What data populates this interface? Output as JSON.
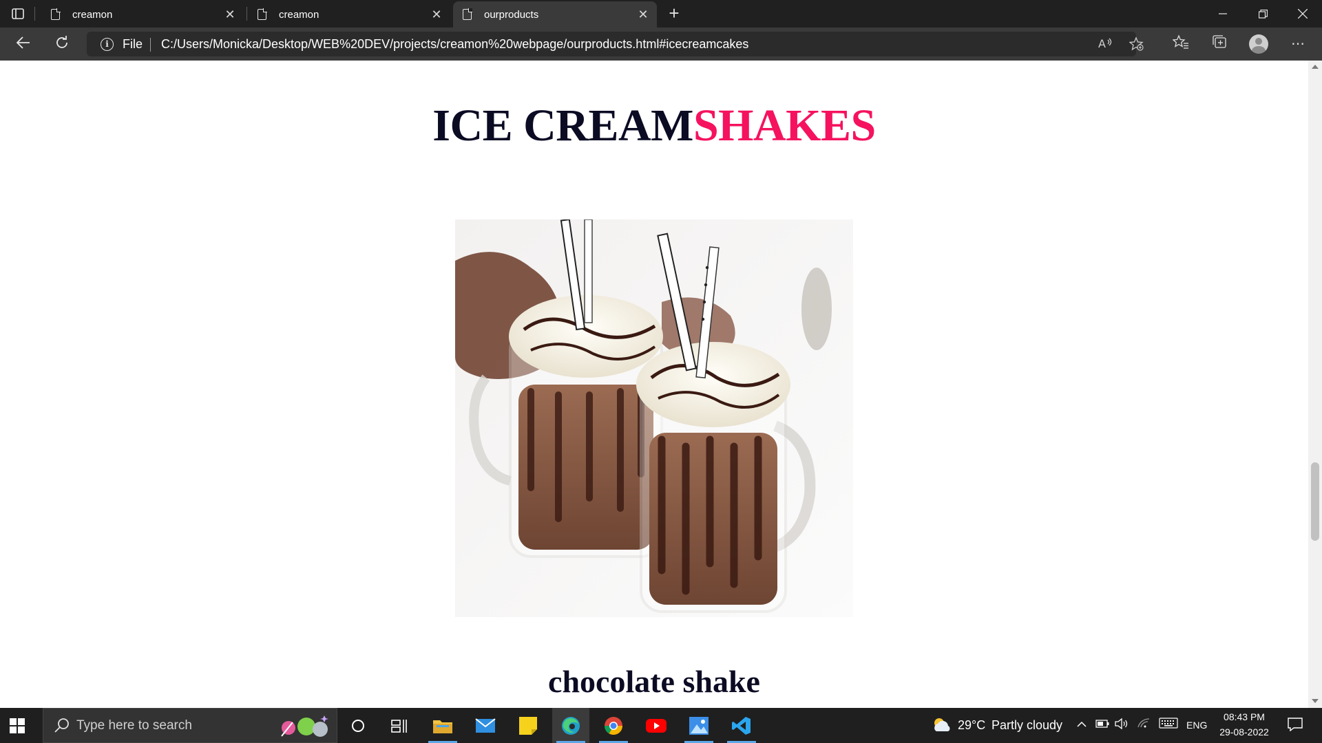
{
  "browser": {
    "tabs": [
      {
        "label": "creamon",
        "active": false
      },
      {
        "label": "creamon",
        "active": false
      },
      {
        "label": "ourproducts",
        "active": true
      }
    ],
    "address": {
      "scheme_label": "File",
      "url": "C:/Users/Monicka/Desktop/WEB%20DEV/projects/creamon%20webpage/ourproducts.html#icecreamcakes"
    }
  },
  "page": {
    "heading_dark": "ICE CREAM",
    "heading_accent": "SHAKES",
    "product_caption": "chocolate shake",
    "colors": {
      "heading_dark": "#0b0b24",
      "heading_accent": "#f5125f"
    }
  },
  "taskbar": {
    "search_placeholder": "Type here to search",
    "weather_temp": "29°C",
    "weather_desc": "Partly cloudy",
    "language": "ENG",
    "time": "08:43 PM",
    "date": "29-08-2022"
  }
}
